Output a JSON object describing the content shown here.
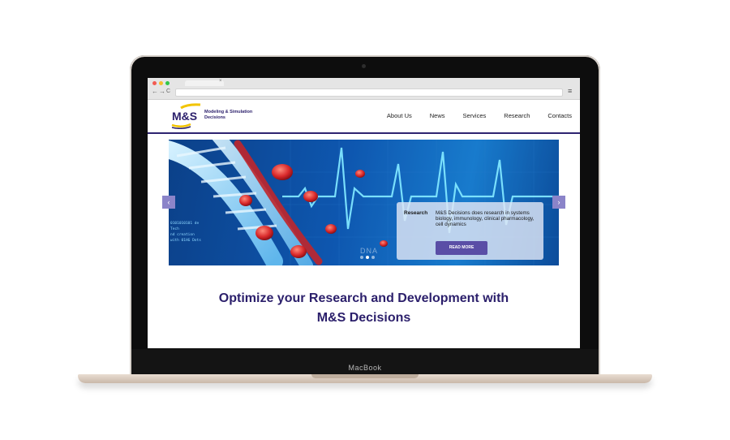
{
  "device": {
    "label": "MacBook"
  },
  "browser": {
    "tab_close": "×",
    "nav_back": "←",
    "nav_forward": "→",
    "nav_reload": "C",
    "menu": "≡"
  },
  "logo": {
    "mark": "M&S",
    "line1": "Modeling & Simulation",
    "line2": "Decisions"
  },
  "nav": {
    "items": [
      {
        "label": "About Us"
      },
      {
        "label": "News"
      },
      {
        "label": "Services"
      },
      {
        "label": "Research"
      },
      {
        "label": "Contacts"
      }
    ]
  },
  "hero": {
    "slide_label": "Research",
    "slide_text": "M&S Decisions does research in systems biology, immunology, clinical pharmacology, cell dynamics",
    "button": "READ MORE",
    "tech_lines": [
      "0101010101 de",
      "Tech",
      "nd creation",
      "with 01HG Dots"
    ],
    "dna_text": "DNA",
    "prev_arrow": "‹",
    "next_arrow": "›",
    "dot_count": 3,
    "active_dot": 1
  },
  "headline": {
    "line1": "Optimize your Research and Development with",
    "line2": "M&S Decisions"
  },
  "colors": {
    "brand": "#2b1f6b",
    "accent": "#5a4ea6",
    "logo_yellow": "#f2c400"
  }
}
